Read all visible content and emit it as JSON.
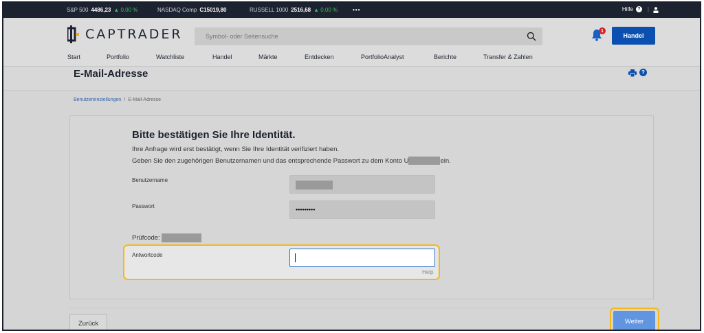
{
  "ticker": {
    "items": [
      {
        "name": "S&P 500",
        "value": "4486,23",
        "change": "▲ 0,00 %"
      },
      {
        "name": "NASDAQ Comp",
        "value": "C15019,80",
        "change": ""
      },
      {
        "name": "RUSSELL 1000",
        "value": "2516,68",
        "change": "▲ 0,00 %"
      }
    ],
    "more": "•••",
    "help_label": "Hilfe",
    "help_symbol": "?",
    "separator": "|",
    "change_color": "#33c25a"
  },
  "header": {
    "brand": "CAPTRADER",
    "search_placeholder": "Symbol- oder Seitensuche",
    "notification_count": "1",
    "trade_button": "Handel",
    "brand_color": "#0b4fb0",
    "icons": [
      "search-icon",
      "bell-icon",
      "user-icon",
      "print-icon",
      "help-icon"
    ]
  },
  "nav": {
    "items": [
      "Start",
      "Portfolio",
      "Watchliste",
      "Handel",
      "Märkte",
      "Entdecken",
      "PortfolioAnalyst",
      "Berichte",
      "Transfer & Zahlen"
    ]
  },
  "page": {
    "title": "E-Mail-Adresse",
    "help_symbol": "?"
  },
  "breadcrumb": {
    "parent": "Benutzereinstellungen",
    "separator": "/",
    "current": "E-Mail-Adresse"
  },
  "form": {
    "heading": "Bitte bestätigen Sie Ihre Identität.",
    "line1": "Ihre Anfrage wird erst bestätigt, wenn Sie Ihre Identität verifiziert haben.",
    "line2_prefix": "Geben Sie den zugehörigen Benutzernamen und das entsprechende Passwort zu dem Konto U",
    "line2_suffix": "ein.",
    "username_label": "Benutzername",
    "password_label": "Passwort",
    "password_value": "•••••••••",
    "check_code_label": "Prüfcode:",
    "answer_label": "Antwortcode",
    "answer_value": "",
    "help_link": "Help"
  },
  "actions": {
    "back": "Zurück",
    "next": "Weiter",
    "highlight_color": "#f4b916"
  }
}
